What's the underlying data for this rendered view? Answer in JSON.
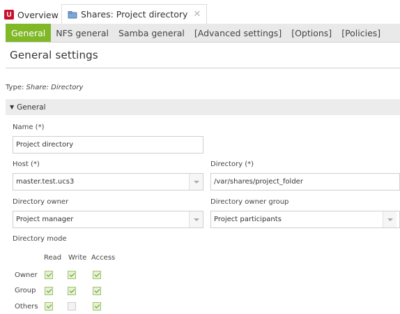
{
  "top_tabs": [
    {
      "label": "Overview",
      "icon": "univention-logo-icon"
    },
    {
      "label": "Shares: Project directory",
      "icon": "share-icon"
    }
  ],
  "sub_tabs": [
    "General",
    "NFS general",
    "Samba general",
    "[Advanced settings]",
    "[Options]",
    "[Policies]"
  ],
  "accent_color": "#80b828",
  "logo_color": "#c8102e",
  "headline": "General settings",
  "type_prefix": "Type: ",
  "type_value": "Share: Directory",
  "section_title": "General",
  "fields": {
    "name": {
      "label": "Name (*)",
      "value": "Project directory"
    },
    "host": {
      "label": "Host (*)",
      "value": "master.test.ucs3"
    },
    "directory": {
      "label": "Directory (*)",
      "value": "/var/shares/project_folder"
    },
    "owner": {
      "label": "Directory owner",
      "value": "Project manager"
    },
    "owner_group": {
      "label": "Directory owner group",
      "value": "Project participants"
    }
  },
  "mode": {
    "label": "Directory mode",
    "columns": [
      "Read",
      "Write",
      "Access"
    ],
    "rows": [
      {
        "label": "Owner",
        "values": [
          true,
          true,
          true
        ]
      },
      {
        "label": "Group",
        "values": [
          true,
          true,
          true
        ]
      },
      {
        "label": "Others",
        "values": [
          true,
          false,
          true
        ]
      }
    ]
  }
}
